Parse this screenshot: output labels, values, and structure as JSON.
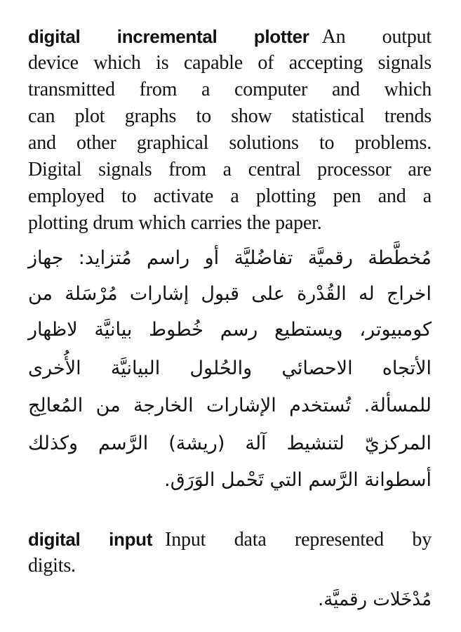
{
  "entries": [
    {
      "term": "digital incremental plotter",
      "english_lines": [
        "An output",
        "device which is capable of accepting signals",
        "transmitted from a computer and which",
        "can plot graphs to show statistical trends",
        "and other graphical solutions to problems.",
        "Digital signals from a central processor are",
        "employed to activate a plotting pen and a",
        "plotting drum which carries the paper."
      ],
      "arabic_lines": [
        "مُخطَّطة رقميَّة تفاضُليَّة أو راسم مُتزايد: جهاز",
        "اخراج له القُدْرة على قبول إشارات مُرْسَلة من",
        "كومبيوتر، ويستطيع رسم خُطوط بيانيَّة لاظهار",
        "الأتجاه الاحصائي والحُلول البيانيَّة الأُخرى",
        "للمسألة. تُستخدم الإشارات الخارجة من المُعالِج",
        "المركزيّ لتنشيط آلة (ريشة) الرَّسم وكذلك",
        "أسطوانة الرَّسم التي تَحْمل الوَرَق."
      ]
    },
    {
      "term": "digital input",
      "english_lines": [
        "Input data represented by",
        "digits."
      ],
      "arabic_lines": [
        "مُدْخَلات رقميَّة."
      ]
    }
  ]
}
